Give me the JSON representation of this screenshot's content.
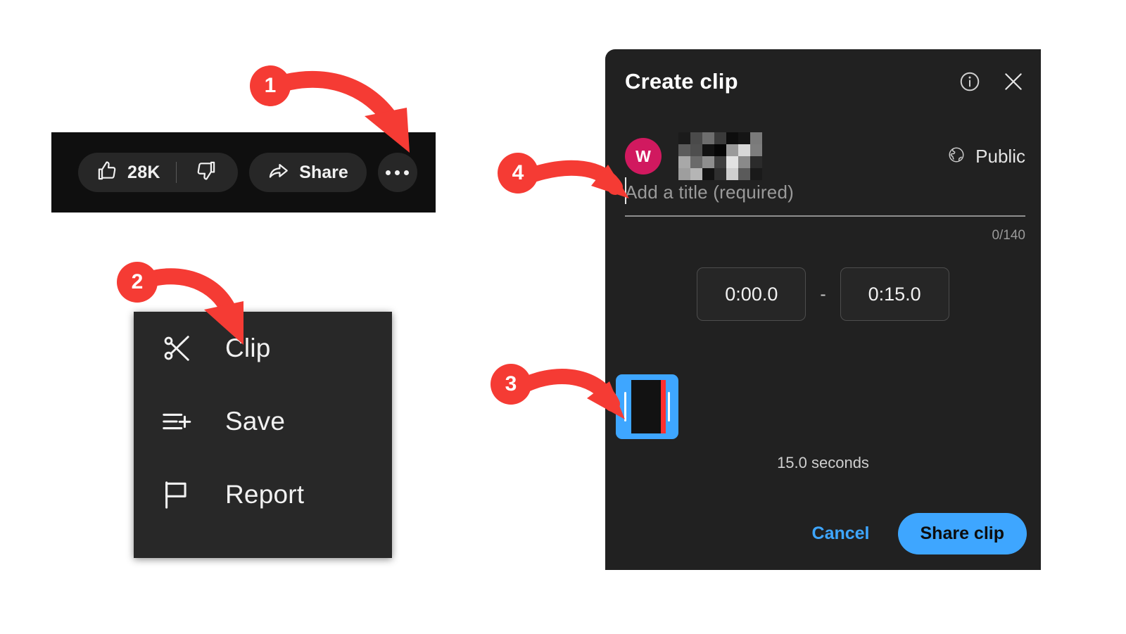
{
  "app": "YouTube clip creation",
  "action_bar": {
    "like_count": "28K",
    "like_icon": "thumb-up-icon",
    "dislike_icon": "thumb-down-icon",
    "share_label": "Share",
    "share_icon": "share-arrow-icon",
    "more_label": "More actions",
    "more_icon": "three-dots-icon"
  },
  "context_menu": {
    "items": [
      {
        "label": "Clip",
        "icon": "scissors-icon"
      },
      {
        "label": "Save",
        "icon": "save-to-playlist-icon"
      },
      {
        "label": "Report",
        "icon": "flag-icon"
      }
    ]
  },
  "clip_dialog": {
    "title": "Create clip",
    "info_icon": "info-circle-icon",
    "close_icon": "close-x-icon",
    "avatar_initial": "W",
    "channel_name_redacted": true,
    "privacy": {
      "label": "Public",
      "icon": "globe-icon"
    },
    "title_input": {
      "value": "",
      "placeholder": "Add a title (required)",
      "counter": "0/140",
      "max_length": 140
    },
    "timestamps": {
      "start": "0:00.0",
      "separator": "-",
      "end": "0:15.0"
    },
    "scrubber": {
      "name": "clip-range-selector",
      "color": "#3ea6ff",
      "playhead_color": "#ff2f2f"
    },
    "duration_label": "15.0 seconds",
    "cancel_label": "Cancel",
    "share_label": "Share clip"
  },
  "annotations": {
    "badge_color": "#f53b34",
    "steps": [
      {
        "number": "1",
        "target": "more-button"
      },
      {
        "number": "2",
        "target": "context-menu-item-clip"
      },
      {
        "number": "3",
        "target": "clip-range-selector"
      },
      {
        "number": "4",
        "target": "title-input"
      }
    ]
  },
  "colors": {
    "dialog_bg": "#212121",
    "menu_bg": "#282828",
    "bar_bg": "#0f0f0f",
    "pill_bg": "#272727",
    "accent_blue": "#3ea6ff",
    "avatar_pink": "#d1195f"
  }
}
